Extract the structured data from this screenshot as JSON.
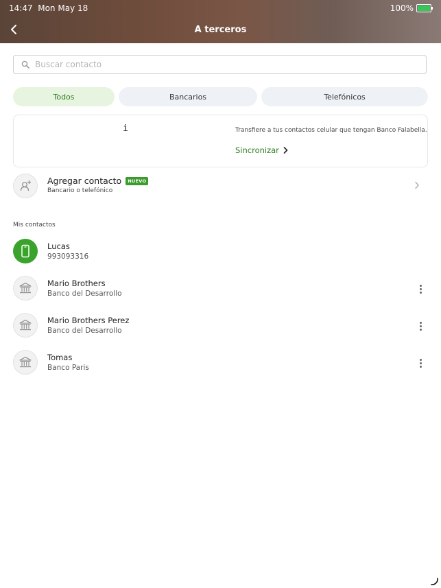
{
  "status_bar": {
    "time": "14:47",
    "date": "Mon May 18",
    "battery": "100%",
    "battery_level": 1.0
  },
  "header": {
    "title": "A terceros",
    "back_icon": "chevron-left-icon"
  },
  "search": {
    "placeholder": "Buscar contacto",
    "value": "",
    "icon": "search-icon"
  },
  "tabs": [
    {
      "label": "Todos",
      "active": true
    },
    {
      "label": "Bancarios",
      "active": false
    },
    {
      "label": "Telefónicos",
      "active": false
    }
  ],
  "sync_card": {
    "glyph": "i",
    "description": "Transfiere a tus contactos celular que tengan Banco Falabella.",
    "link_label": "Sincronizar"
  },
  "add_contact": {
    "label": "Agregar contacto",
    "badge": "NUEVO",
    "subtitle": "Bancario o telefónico",
    "icon": "add-user-icon"
  },
  "section": {
    "label": "Mis contactos"
  },
  "contacts": [
    {
      "name": "Lucas",
      "detail": "993093316",
      "type": "phone",
      "icon": "phone-icon"
    },
    {
      "name": "Mario Brothers",
      "detail": "Banco del Desarrollo",
      "type": "bank",
      "icon": "bank-icon"
    },
    {
      "name": "Mario Brothers Perez",
      "detail": "Banco del Desarrollo",
      "type": "bank",
      "icon": "bank-icon"
    },
    {
      "name": "Tomas",
      "detail": "Banco Paris",
      "type": "bank",
      "icon": "bank-icon"
    }
  ],
  "colors": {
    "accent_green": "#3aa32c",
    "link_green": "#2f7d22",
    "active_tab_bg": "#e7f4e0",
    "inactive_tab_bg": "#eef2f7"
  }
}
